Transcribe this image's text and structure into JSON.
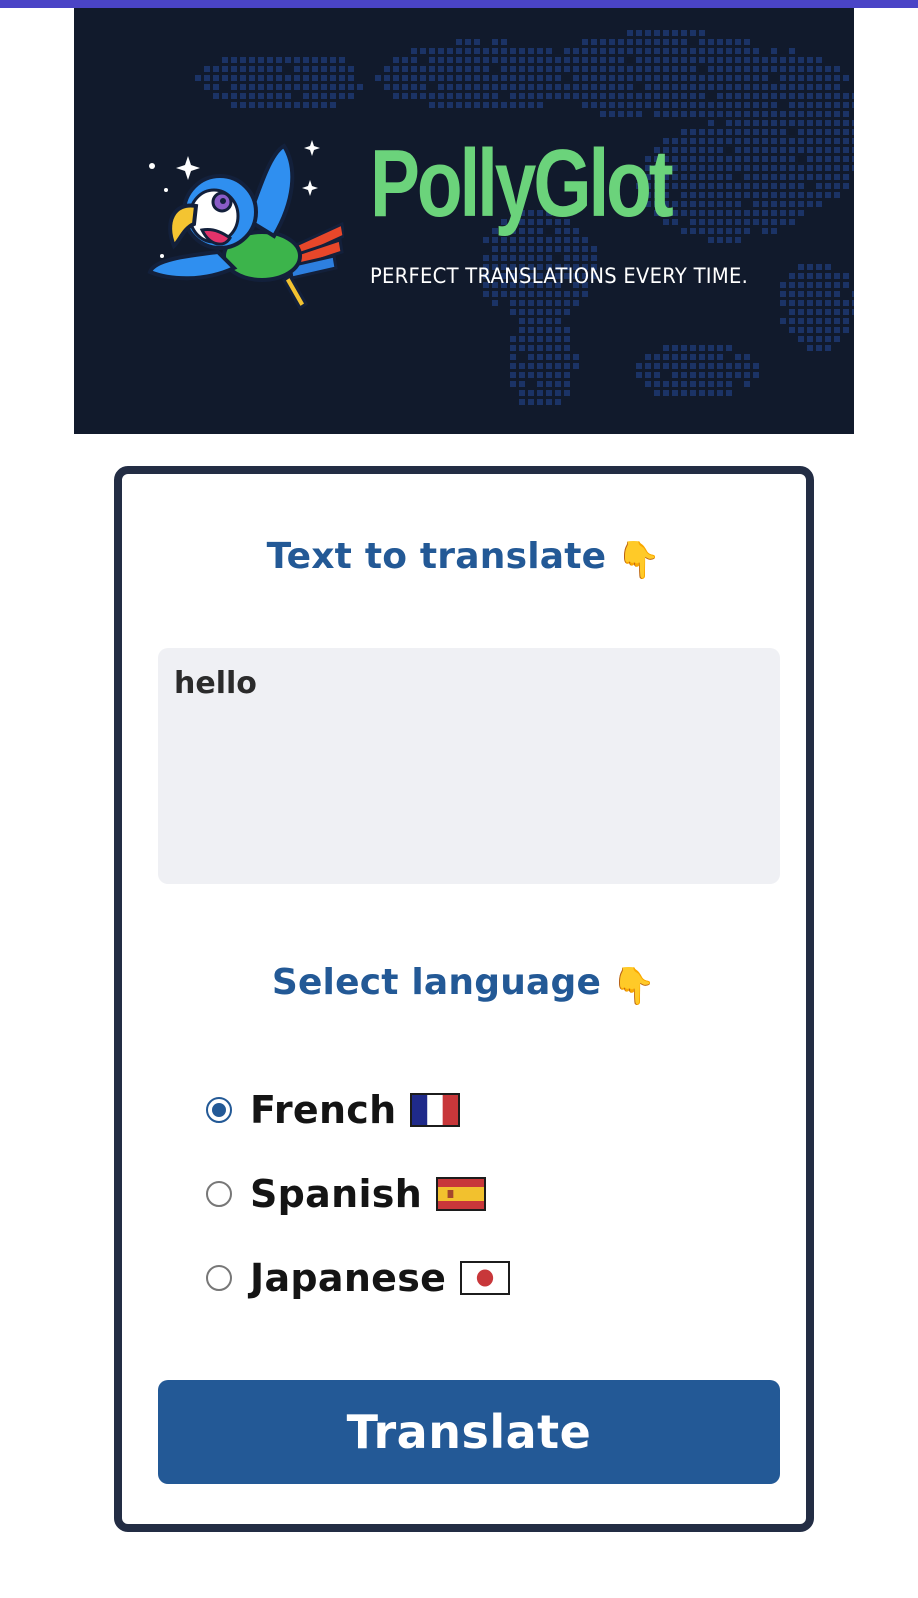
{
  "colors": {
    "topbar": "#4a44c6",
    "hero_bg": "#111a2c",
    "map_dots": "#1e3a75",
    "brand_green": "#6bd37b",
    "heading_blue": "#235996",
    "textarea_bg": "#eff0f4",
    "card_border": "#232d44",
    "button_bg": "#235996",
    "radio_checked": "#235996"
  },
  "header": {
    "title": "PollyGlot",
    "tagline": "PERFECT TRANSLATIONS EVERY TIME.",
    "logo_icon": "parrot-icon",
    "background_icon": "world-map-dots"
  },
  "form": {
    "text_heading": "Text to translate",
    "text_heading_emoji": "👇",
    "input_value": "hello",
    "language_heading": "Select language",
    "language_heading_emoji": "👇",
    "languages": [
      {
        "label": "French",
        "flag_icon": "flag-france-icon",
        "checked": true
      },
      {
        "label": "Spanish",
        "flag_icon": "flag-spain-icon",
        "checked": false
      },
      {
        "label": "Japanese",
        "flag_icon": "flag-japan-icon",
        "checked": false
      }
    ],
    "submit_label": "Translate"
  }
}
